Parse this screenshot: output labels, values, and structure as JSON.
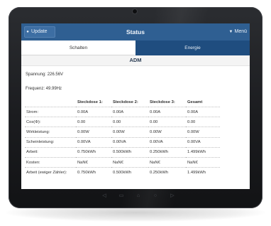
{
  "topbar": {
    "update_label": "Update",
    "update_icon": "refresh-icon",
    "title": "Status",
    "menu_label": "Menü",
    "menu_icon": "chevron-down-icon"
  },
  "tabs": [
    {
      "label": "Schalten",
      "active": true
    },
    {
      "label": "Energie",
      "active": false
    }
  ],
  "section": {
    "title": "ADM"
  },
  "info": {
    "voltage": "Spannung: 226.56V",
    "frequency": "Frequenz: 49.99Hz"
  },
  "table": {
    "headers": [
      "",
      "Steckdose 1:",
      "Steckdose 2:",
      "Steckdose 3:",
      "Gesamt"
    ],
    "rows": [
      [
        "Strom:",
        "0.00A",
        "0.00A",
        "0.00A",
        "0.00A"
      ],
      [
        "Cos(Φ):",
        "0.00",
        "0.00",
        "0.00",
        "0.00"
      ],
      [
        "Wirkleistung:",
        "0.00W",
        "0.00W",
        "0.00W",
        "0.00W"
      ],
      [
        "Scheinleistung:",
        "0.00VA",
        "0.00VA",
        "0.00VA",
        "0.00VA"
      ],
      [
        "Arbeit:",
        "0.750kWh",
        "0.500kWh",
        "0.250kWh",
        "1.499kWh"
      ],
      [
        "Kosten:",
        "NaN€",
        "NaN€",
        "NaN€",
        "NaN€"
      ],
      [
        "Arbeit (ewiger Zähler):",
        "0.750kWh",
        "0.500kWh",
        "0.250kWh",
        "1.499kWh"
      ]
    ]
  },
  "colors": {
    "header": "#2f5f92",
    "active_tab_dark": "#1f4d7f",
    "bezel": "#1b1c1f"
  },
  "device_nav": {
    "icons": [
      "back-icon",
      "home-outline-icon",
      "home-icon",
      "search-icon",
      "menu-icon"
    ]
  }
}
